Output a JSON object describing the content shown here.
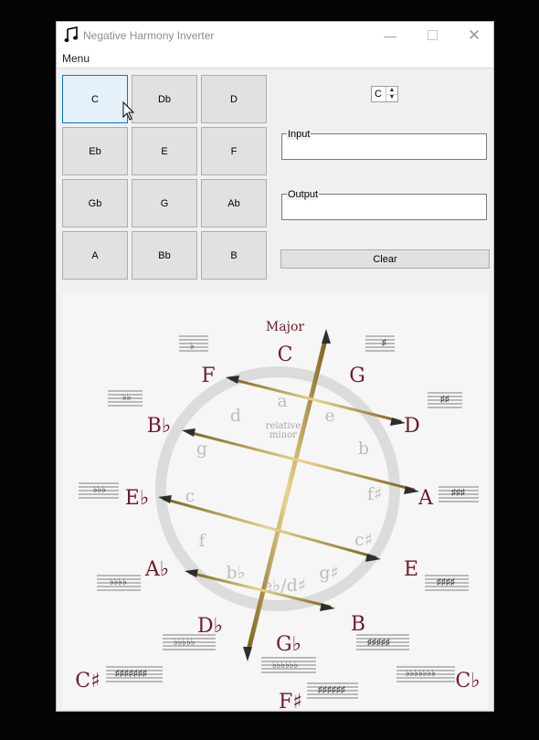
{
  "window": {
    "title": "Negative Harmony Inverter",
    "menu_label": "Menu"
  },
  "keys": [
    "C",
    "Db",
    "D",
    "Eb",
    "E",
    "F",
    "Gb",
    "G",
    "Ab",
    "A",
    "Bb",
    "B"
  ],
  "selected_key": "C",
  "key_spinner": {
    "value": "C"
  },
  "input_group": {
    "label": "Input",
    "value": ""
  },
  "output_group": {
    "label": "Output",
    "value": ""
  },
  "clear_label": "Clear",
  "diagram": {
    "heading": "Major",
    "center_label_1": "relative",
    "center_label_2": "minor",
    "major_keys": [
      "C",
      "G",
      "D",
      "A",
      "E",
      "B",
      "G♭",
      "D♭",
      "A♭",
      "E♭",
      "B♭",
      "F",
      "F♯",
      "C♯",
      "C♭"
    ],
    "minor_keys": [
      "a",
      "e",
      "b",
      "f♯",
      "c♯",
      "g♯",
      "e♭/d♯",
      "b♭",
      "f",
      "c",
      "g",
      "d"
    ],
    "colors": {
      "major_text": "#6e1b2b",
      "minor_text": "#b8b8b8",
      "ring": "#dedede",
      "rod": "#b69a4a"
    }
  }
}
